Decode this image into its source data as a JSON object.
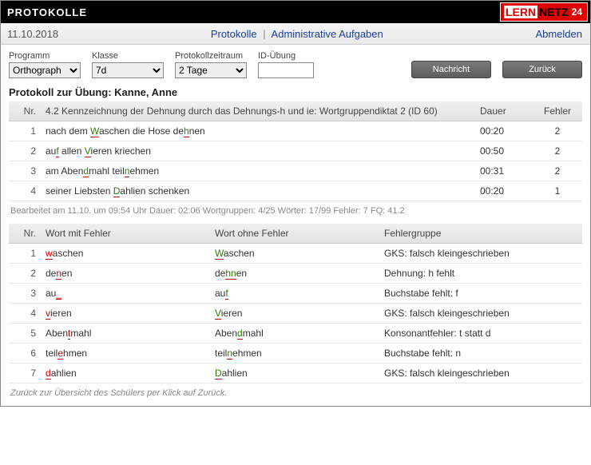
{
  "header": {
    "title": "PROTOKOLLE",
    "logo_a": "LERN",
    "logo_b": "NETZ",
    "logo_c": "24"
  },
  "subbar": {
    "date": "11.10.2018",
    "link1": "Protokolle",
    "link2": "Administrative Aufgaben",
    "logout": "Abmelden"
  },
  "controls": {
    "program_label": "Programm",
    "program_value": "Orthograph",
    "class_label": "Klasse",
    "class_value": "7d",
    "period_label": "Protokollzeitraum",
    "period_value": "2 Tage",
    "id_label": "ID-Übung",
    "id_value": "",
    "btn_message": "Nachricht",
    "btn_back": "Zurück"
  },
  "section_title": "Protokoll zur Übung: Kanne, Anne",
  "t1": {
    "headers": {
      "nr": "Nr.",
      "task": "4.2 Kennzeichnung der Dehnung durch das Dehnungs-h und ie: Wortgruppendiktat 2 (ID 60)",
      "dauer": "Dauer",
      "fehler": "Fehler"
    },
    "rows": [
      {
        "nr": 1,
        "segments": [
          [
            "nach dem ",
            "n"
          ],
          [
            "W",
            "m"
          ],
          [
            "aschen die Hose de",
            "n"
          ],
          [
            "h",
            "m"
          ],
          [
            "nen",
            "n"
          ]
        ],
        "dauer": "00:20",
        "fehler": 2
      },
      {
        "nr": 2,
        "segments": [
          [
            "au",
            "n"
          ],
          [
            "f",
            "m"
          ],
          [
            " allen ",
            "n"
          ],
          [
            "V",
            "m"
          ],
          [
            "ieren kriechen",
            "n"
          ]
        ],
        "dauer": "00:50",
        "fehler": 2
      },
      {
        "nr": 3,
        "segments": [
          [
            "am Aben",
            "n"
          ],
          [
            "d",
            "m"
          ],
          [
            "mahl teil",
            "n"
          ],
          [
            "n",
            "m"
          ],
          [
            "ehmen",
            "n"
          ]
        ],
        "dauer": "00:31",
        "fehler": 2
      },
      {
        "nr": 4,
        "segments": [
          [
            "seiner Liebsten ",
            "n"
          ],
          [
            "D",
            "m"
          ],
          [
            "ahlien schenken",
            "n"
          ]
        ],
        "dauer": "00:20",
        "fehler": 1
      }
    ],
    "meta": "Bearbeitet am 11.10.  um  09:54 Uhr    Dauer: 02:06    Wortgruppen: 4/25    Wörter: 17/99    Fehler: 7    FQ: 41.2"
  },
  "t2": {
    "headers": {
      "nr": "Nr.",
      "wrong": "Wort mit Fehler",
      "right": "Wort ohne Fehler",
      "group": "Fehlergruppe"
    },
    "rows": [
      {
        "nr": 1,
        "wrong": [
          [
            "w",
            "e"
          ],
          [
            "aschen",
            "n"
          ]
        ],
        "right": [
          [
            "W",
            "m"
          ],
          [
            "aschen",
            "n"
          ]
        ],
        "group": "GKS: falsch kleingeschrieben"
      },
      {
        "nr": 2,
        "wrong": [
          [
            "de",
            "n"
          ],
          [
            "n",
            "e"
          ],
          [
            "en",
            "n"
          ]
        ],
        "right": [
          [
            "de",
            "n"
          ],
          [
            "hn",
            "m"
          ],
          [
            "en",
            "n"
          ]
        ],
        "group": "Dehnung: h fehlt"
      },
      {
        "nr": 3,
        "wrong": [
          [
            "au",
            "n"
          ],
          [
            "_",
            "e"
          ]
        ],
        "right": [
          [
            "au",
            "n"
          ],
          [
            "f",
            "m"
          ]
        ],
        "group": "Buchstabe fehlt: f"
      },
      {
        "nr": 4,
        "wrong": [
          [
            "v",
            "e"
          ],
          [
            "ieren",
            "n"
          ]
        ],
        "right": [
          [
            "V",
            "m"
          ],
          [
            "ieren",
            "n"
          ]
        ],
        "group": "GKS: falsch kleingeschrieben"
      },
      {
        "nr": 5,
        "wrong": [
          [
            "Aben",
            "n"
          ],
          [
            "t",
            "e"
          ],
          [
            "mahl",
            "n"
          ]
        ],
        "right": [
          [
            "Aben",
            "n"
          ],
          [
            "d",
            "m"
          ],
          [
            "mahl",
            "n"
          ]
        ],
        "group": "Konsonantfehler: t statt d"
      },
      {
        "nr": 6,
        "wrong": [
          [
            "teil",
            "n"
          ],
          [
            "e",
            "e"
          ],
          [
            "hmen",
            "n"
          ]
        ],
        "right": [
          [
            "teil",
            "n"
          ],
          [
            "n",
            "m"
          ],
          [
            "ehmen",
            "n"
          ]
        ],
        "group": "Buchstabe fehlt: n"
      },
      {
        "nr": 7,
        "wrong": [
          [
            "d",
            "e"
          ],
          [
            "ahlien",
            "n"
          ]
        ],
        "right": [
          [
            "D",
            "m"
          ],
          [
            "ahlien",
            "n"
          ]
        ],
        "group": "GKS: falsch kleingeschrieben"
      }
    ]
  },
  "footnote": "Zurück zur Übersicht des Schülers per Klick auf Zurück."
}
